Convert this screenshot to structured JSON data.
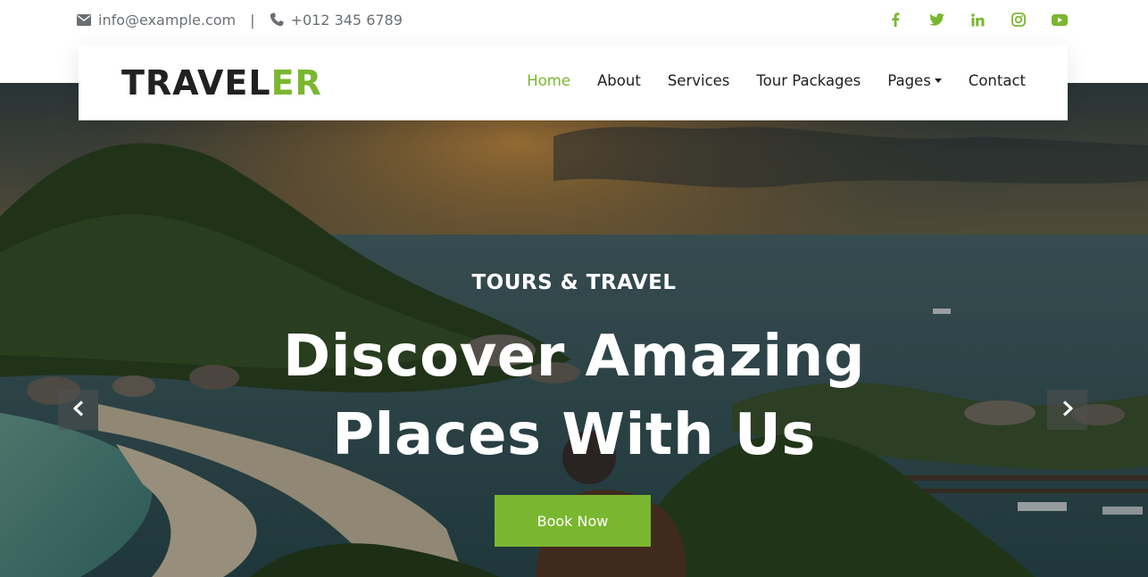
{
  "topbar": {
    "email": "info@example.com",
    "separator": "|",
    "phone": "+012 345 6789",
    "socials": [
      "facebook-icon",
      "twitter-icon",
      "linkedin-icon",
      "instagram-icon",
      "youtube-icon"
    ]
  },
  "brand": {
    "logo_part1": "TRAVEL",
    "logo_part2": "ER"
  },
  "nav": {
    "items": [
      {
        "label": "Home",
        "active": true
      },
      {
        "label": "About"
      },
      {
        "label": "Services"
      },
      {
        "label": "Tour Packages"
      },
      {
        "label": "Pages",
        "dropdown": true
      },
      {
        "label": "Contact"
      }
    ]
  },
  "hero": {
    "eyebrow": "TOURS & TRAVEL",
    "headline_line1": "Discover Amazing",
    "headline_line2": "Places With Us",
    "cta_label": "Book Now",
    "prev_icon": "chevron-left-icon",
    "next_icon": "chevron-right-icon"
  },
  "colors": {
    "accent": "#7ab730",
    "text_dark": "#212121",
    "text_muted": "#6b6f73"
  }
}
